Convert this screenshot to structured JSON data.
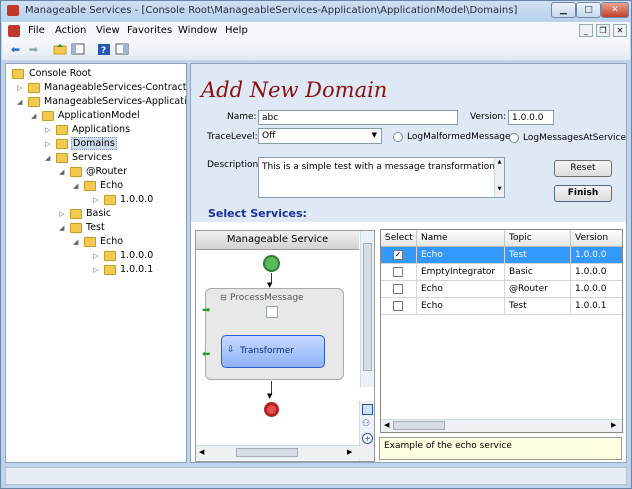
{
  "window": {
    "title": "Manageable Services - [Console Root\\ManageableServices-Application\\ApplicationModel\\Domains]"
  },
  "menu": [
    "File",
    "Action",
    "View",
    "Favorites",
    "Window",
    "Help"
  ],
  "tree": [
    {
      "label": "Console Root"
    },
    {
      "label": "ManageableServices-Contract"
    },
    {
      "label": "ManageableServices-Application"
    },
    {
      "label": "ApplicationModel"
    },
    {
      "label": "Applications"
    },
    {
      "label": "Domains"
    },
    {
      "label": "Services"
    },
    {
      "label": "@Router"
    },
    {
      "label": "Echo"
    },
    {
      "label": "1.0.0.0"
    },
    {
      "label": "Basic"
    },
    {
      "label": "Test"
    },
    {
      "label": "Echo"
    },
    {
      "label": "1.0.0.0"
    },
    {
      "label": "1.0.0.1"
    }
  ],
  "form": {
    "title": "Add New Domain",
    "name_label": "Name:",
    "name_value": "abc",
    "version_label": "Version:",
    "version_value": "1.0.0.0",
    "tracelevel_label": "TraceLevel:",
    "tracelevel_value": "Off",
    "log_malformed_label": "LogMalformedMessages",
    "log_at_service_label": "LogMessagesAtServiceLev",
    "description_label": "Description:",
    "description_value": "This is a simple test with a message transformation",
    "reset_label": "Reset",
    "finish_label": "Finish",
    "select_services_label": "Select Services:"
  },
  "designer": {
    "header": "Manageable Service",
    "sequence_label": "ProcessMessage",
    "activity_label": "Transformer"
  },
  "grid": {
    "columns": [
      "Select",
      "Name",
      "Topic",
      "Version"
    ],
    "rows": [
      {
        "checked": true,
        "name": "Echo",
        "topic": "Test",
        "version": "1.0.0.0"
      },
      {
        "checked": false,
        "name": "EmptyIntegrator",
        "topic": "Basic",
        "version": "1.0.0.0"
      },
      {
        "checked": false,
        "name": "Echo",
        "topic": "@Router",
        "version": "1.0.0.0"
      },
      {
        "checked": false,
        "name": "Echo",
        "topic": "Test",
        "version": "1.0.0.1"
      }
    ],
    "selected_row": 0,
    "description": "Example of the echo service"
  },
  "colors": {
    "title_red": "#8a1010",
    "section_blue": "#1a2fa0",
    "row_selected": "#3399ff"
  }
}
